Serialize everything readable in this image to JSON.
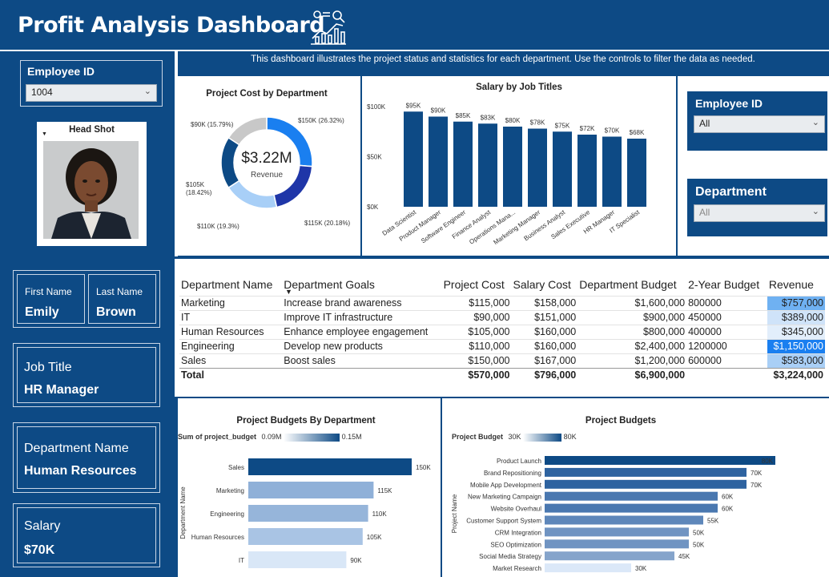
{
  "header": {
    "title": "Profit Analysis Dashboard",
    "icon": "chart-search-icon"
  },
  "subtitle": "This dashboard illustrates the project status and statistics for each department. Use the controls to filter the data as needed.",
  "left": {
    "employee_id_label": "Employee ID",
    "employee_id_value": "1004",
    "headshot_title": "Head Shot",
    "first_name_label": "First Name",
    "first_name_value": "Emily",
    "last_name_label": "Last Name",
    "last_name_value": "Brown",
    "job_title_label": "Job Title",
    "job_title_value": "HR Manager",
    "dept_label": "Department Name",
    "dept_value": "Human Resources",
    "salary_label": "Salary",
    "salary_value": "$70K"
  },
  "filters": {
    "employee_id_label": "Employee ID",
    "employee_id_value": "All",
    "department_label": "Department",
    "department_value": "All"
  },
  "donut": {
    "title": "Project Cost by Department",
    "center_value": "$3.22M",
    "center_label": "Revenue"
  },
  "salary_chart": {
    "title": "Salary by Job Titles"
  },
  "table": {
    "headers": [
      "Department Name",
      "Department Goals",
      "Project Cost",
      "Salary Cost",
      "Department Budget",
      "2-Year Budget",
      "Revenue"
    ],
    "rows": [
      [
        "Marketing",
        "Increase brand awareness",
        "$115,000",
        "$158,000",
        "$1,600,000",
        "800000",
        "$757,000"
      ],
      [
        "IT",
        "Improve IT infrastructure",
        "$90,000",
        "$151,000",
        "$900,000",
        "450000",
        "$389,000"
      ],
      [
        "Human Resources",
        "Enhance employee engagement",
        "$105,000",
        "$160,000",
        "$800,000",
        "400000",
        "$345,000"
      ],
      [
        "Engineering",
        "Develop new products",
        "$110,000",
        "$160,000",
        "$2,400,000",
        "1200000",
        "$1,150,000"
      ],
      [
        "Sales",
        "Boost sales",
        "$150,000",
        "$167,000",
        "$1,200,000",
        "600000",
        "$583,000"
      ]
    ],
    "total": [
      "Total",
      "",
      "$570,000",
      "$796,000",
      "$6,900,000",
      "",
      "$3,224,000"
    ],
    "revenue_colors": [
      "#6fb1f2",
      "#cfe3f9",
      "#e2eefb",
      "#1a7ff0",
      "#a9cff6"
    ]
  },
  "budgets_dept": {
    "title": "Project Budgets By Department",
    "legend_label": "Sum of project_budget",
    "legend_min": "0.09M",
    "legend_max": "0.15M",
    "axis_label": "Department Name"
  },
  "budgets_proj": {
    "title": "Project Budgets",
    "legend_label": "Project Budget",
    "legend_min": "30K",
    "legend_max": "80K",
    "axis_label": "Project Name"
  },
  "chart_data": [
    {
      "type": "pie",
      "title": "Project Cost by Department",
      "slices": [
        {
          "label": "$150K (26.32%)",
          "value": 150,
          "color": "#1a7ff0"
        },
        {
          "label": "$115K (20.18%)",
          "value": 115,
          "color": "#1f36a8"
        },
        {
          "label": "$110K (19.3%)",
          "value": 110,
          "color": "#a8cff7"
        },
        {
          "label": "$105K (18.42%)",
          "value": 105,
          "color": "#0d4a85"
        },
        {
          "label": "$90K (15.79%)",
          "value": 90,
          "color": "#c8c8c8"
        }
      ]
    },
    {
      "type": "bar",
      "title": "Salary by Job Titles",
      "categories": [
        "Data Scientist",
        "Product Manager",
        "Software Engineer",
        "Finance Analyst",
        "Operations Mana...",
        "Marketing Manager",
        "Business Analyst",
        "Sales Executive",
        "HR Manager",
        "IT Specialist"
      ],
      "values": [
        95,
        90,
        85,
        83,
        80,
        78,
        75,
        72,
        70,
        68
      ],
      "labels": [
        "$95K",
        "$90K",
        "$85K",
        "$83K",
        "$80K",
        "$78K",
        "$75K",
        "$72K",
        "$70K",
        "$68K"
      ],
      "yticks": [
        "$0K",
        "$50K",
        "$100K"
      ],
      "ylim": [
        0,
        100
      ],
      "color": "#0d4a85"
    },
    {
      "type": "bar",
      "title": "Project Budgets By Department",
      "categories": [
        "Sales",
        "Marketing",
        "Engineering",
        "Human Resources",
        "IT"
      ],
      "values": [
        150,
        115,
        110,
        105,
        90
      ],
      "labels": [
        "150K",
        "115K",
        "110K",
        "105K",
        "90K"
      ],
      "colors": [
        "#0d4a85",
        "#8fb0d8",
        "#96b5da",
        "#a9c4e4",
        "#d9e7f7"
      ],
      "xlim": [
        0,
        150
      ]
    },
    {
      "type": "bar",
      "title": "Project Budgets",
      "categories": [
        "Product Launch",
        "Brand Repositioning",
        "Mobile App Development",
        "New Marketing Campaign",
        "Website Overhaul",
        "Customer Support System",
        "CRM Integration",
        "SEO Optimization",
        "Social Media Strategy",
        "Market Research"
      ],
      "values": [
        80,
        70,
        70,
        60,
        60,
        55,
        50,
        50,
        45,
        30
      ],
      "labels": [
        "80K",
        "70K",
        "70K",
        "60K",
        "60K",
        "55K",
        "50K",
        "50K",
        "45K",
        "30K"
      ],
      "colors": [
        "#0d4a85",
        "#2e63a0",
        "#2e63a0",
        "#4a78b0",
        "#4a78b0",
        "#5e87ba",
        "#7094c2",
        "#7094c2",
        "#85a4cb",
        "#dbe8f8"
      ],
      "xlim": [
        0,
        80
      ]
    }
  ]
}
